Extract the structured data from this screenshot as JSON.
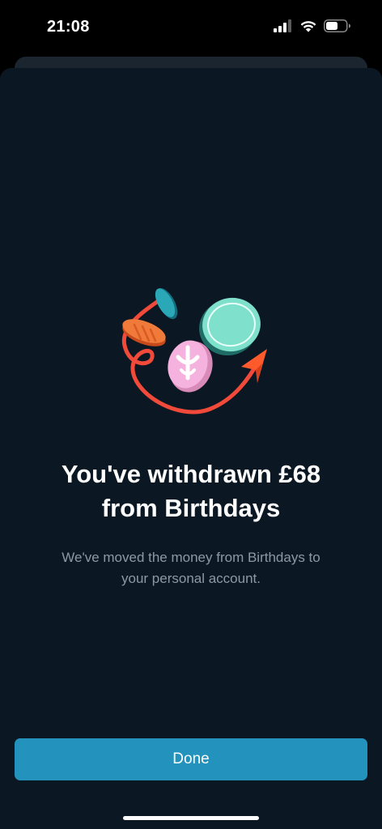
{
  "status_bar": {
    "time": "21:08"
  },
  "colors": {
    "sheet_background": "#0b1823",
    "button_background": "#2393bd",
    "title_text": "#ffffff",
    "subtitle_text": "#8e98a3"
  },
  "illustration": {
    "icon": "coins-with-arrow-illustration"
  },
  "content": {
    "title_line1": "You've withdrawn £68",
    "title_line2": "from Birthdays",
    "subtitle_line1": "We've moved the money from Birthdays to",
    "subtitle_line2": "your personal account."
  },
  "actions": {
    "done_label": "Done"
  }
}
